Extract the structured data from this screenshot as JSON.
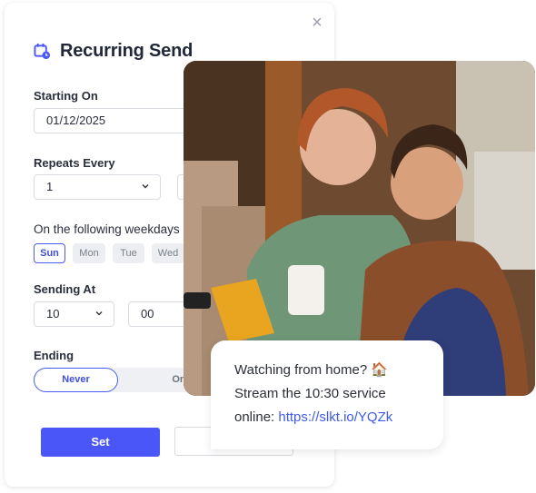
{
  "dialog": {
    "title": "Recurring Send",
    "title_icon": "calendar-clock-icon",
    "close_icon": "close-icon",
    "close_glyph": "×",
    "starting_on": {
      "label": "Starting On",
      "value": "01/12/2025"
    },
    "repeats_every": {
      "label": "Repeats Every",
      "value": "1"
    },
    "weekdays": {
      "label": "On the following weekdays",
      "days": [
        {
          "label": "Sun",
          "selected": true
        },
        {
          "label": "Mon",
          "selected": false
        },
        {
          "label": "Tue",
          "selected": false
        },
        {
          "label": "Wed",
          "selected": false
        }
      ]
    },
    "sending_at": {
      "label": "Sending At",
      "hour": "10",
      "minute": "00"
    },
    "ending": {
      "label": "Ending",
      "options": [
        "Never",
        "On"
      ],
      "selected": "Never"
    },
    "set_button": "Set"
  },
  "accent_color": "#4a56f7",
  "photo": {
    "description": "Couple laughing on a couch at home holding a mug and TV remote"
  },
  "message": {
    "line1": "Watching from home? 🏠",
    "line2": "Stream the 10:30 service",
    "line3_prefix": "online: ",
    "link": "https://slkt.io/YQZk"
  }
}
